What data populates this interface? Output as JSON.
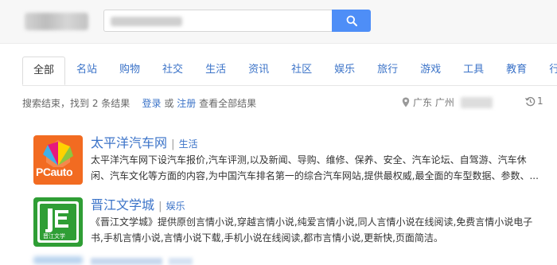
{
  "search": {
    "button_icon": "search-icon",
    "button_color": "#4e8ef7"
  },
  "tabs": [
    {
      "label": "全部",
      "active": true
    },
    {
      "label": "名站"
    },
    {
      "label": "购物"
    },
    {
      "label": "社交"
    },
    {
      "label": "生活"
    },
    {
      "label": "资讯"
    },
    {
      "label": "社区"
    },
    {
      "label": "娱乐"
    },
    {
      "label": "旅行"
    },
    {
      "label": "游戏"
    },
    {
      "label": "工具"
    },
    {
      "label": "教育"
    },
    {
      "label": "行"
    }
  ],
  "status": {
    "summary": "搜索结束，找到 2 条结果",
    "login": "登录",
    "or": "或",
    "register": "注册",
    "view_all": "查看全部结果",
    "location_icon": "location-pin-icon",
    "location": "广东 广州",
    "history_icon": "history-icon",
    "history_count": "1"
  },
  "results": [
    {
      "title": "太平洋汽车网",
      "category": "生活",
      "description": "太平洋汽车网下设汽车报价,汽车评测,以及新闻、导购、维修、保养、安全、汽车论坛、自驾游、汽车休闲、汽车文化等方面的内容,为中国汽车排名第一的综合汽车网站,提供最权威,最全面的车型数据、参数、...",
      "logo_text": "PCauto",
      "logo_icon": "pcauto-logo-icon"
    },
    {
      "title": "晋江文学城",
      "category": "娱乐",
      "description": "《晋江文学城》提供原创言情小说,穿越言情小说,纯爱言情小说,同人言情小说在线阅读,免费言情小说电子书,手机言情小说,言情小说下载,手机小说在线阅读,都市言情小说,更新快,页面简洁。",
      "logo_text": "晋江文学",
      "logo_icon": "jjwxc-logo-icon"
    }
  ],
  "colors": {
    "link": "#3b73c8",
    "pcauto_orange": "#f26b21",
    "jjwxc_green": "#2f9e35"
  }
}
